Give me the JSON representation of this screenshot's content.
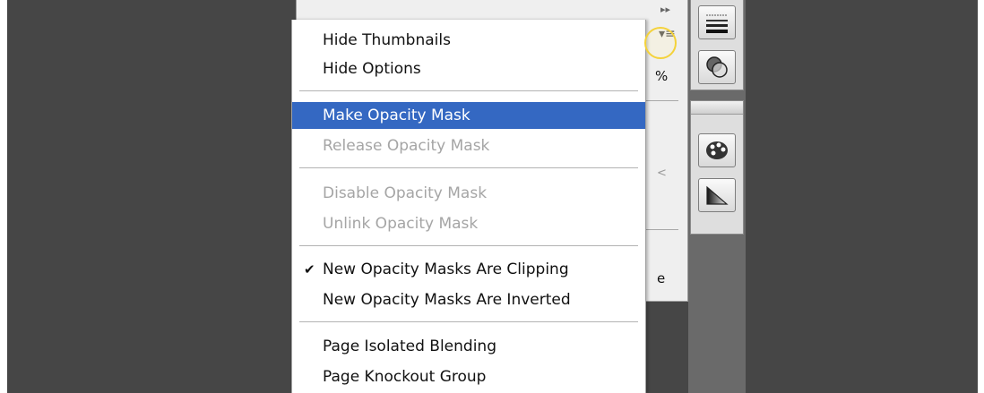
{
  "menu": {
    "items": [
      {
        "label": "Hide Thumbnails"
      },
      {
        "label": "Hide Options"
      },
      {
        "label": "Make Opacity Mask"
      },
      {
        "label": "Release Opacity Mask"
      },
      {
        "label": "Disable Opacity Mask"
      },
      {
        "label": "Unlink Opacity Mask"
      },
      {
        "label": "New Opacity Masks Are Clipping"
      },
      {
        "label": "New Opacity Masks Are Inverted"
      },
      {
        "label": "Page Isolated Blending"
      },
      {
        "label": "Page Knockout Group"
      }
    ]
  },
  "panel": {
    "collapse_glyph": "▸▸",
    "menu_glyph": "▾≡",
    "percent_suffix": "%",
    "cut_text_1": "<",
    "cut_text_2": "e"
  },
  "colors": {
    "highlight": "#3468c2",
    "disabled": "#a5a5a5",
    "background": "#464646"
  },
  "icons": [
    "checkmark-icon",
    "panel-menu-icon",
    "transparency-icon",
    "color-palette-icon",
    "gradient-icon",
    "stroke-icon"
  ]
}
